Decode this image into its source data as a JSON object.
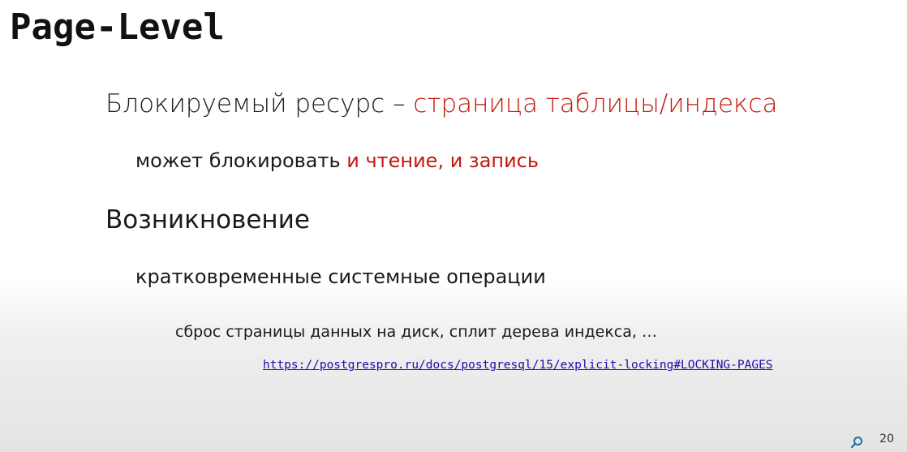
{
  "slide": {
    "title": "Page-Level",
    "line1": {
      "prefix": "Блокируемый ресурс – ",
      "highlight": "страница таблицы/индекса"
    },
    "line2": {
      "prefix": "может блокировать ",
      "highlight": "и чтение, и запись"
    },
    "line3": "Возникновение",
    "line4": "кратковременные системные операции",
    "line5": "сброс страницы данных на диск, сплит дерева индекса, …",
    "link": "https://postgrespro.ru/docs/postgresql/15/explicit-locking#LOCKING-PAGES",
    "page_number": "20"
  },
  "colors": {
    "accent": "#c4180c",
    "link": "#1a0dab",
    "search_icon": "#1b6fa8"
  },
  "icons": {
    "search": "search-icon"
  }
}
